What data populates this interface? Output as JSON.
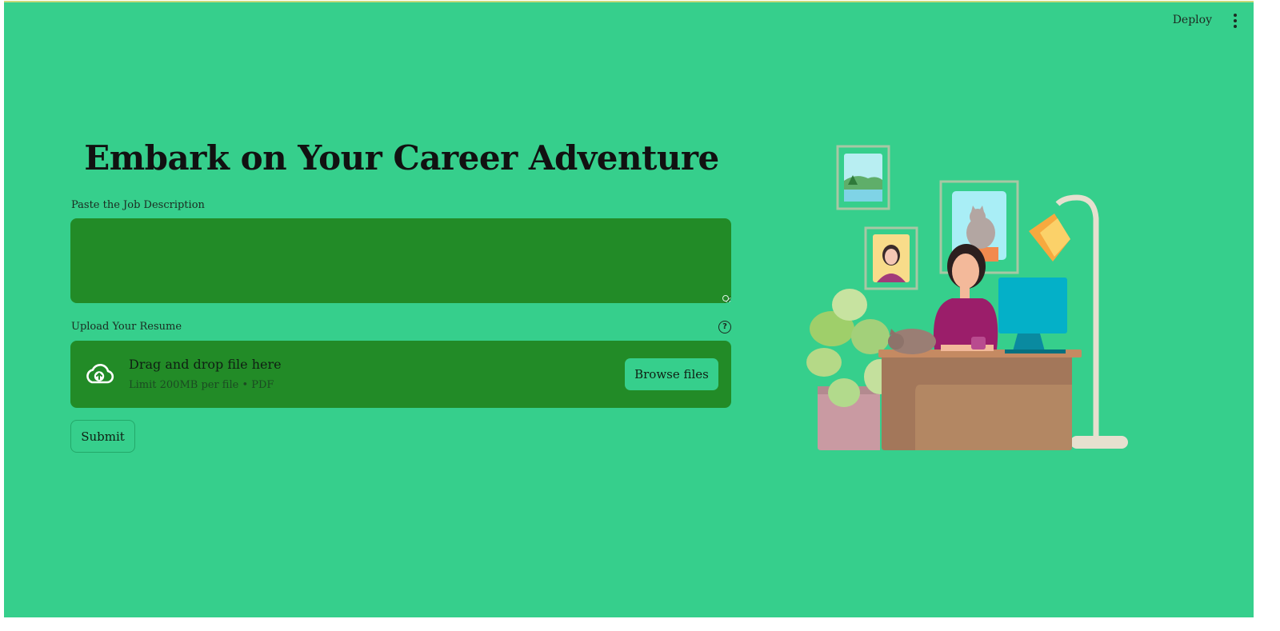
{
  "header": {
    "deploy_label": "Deploy",
    "menu_icon": "kebab-menu-icon"
  },
  "main": {
    "title": "Embark on Your Career Adventure",
    "job_description": {
      "label": "Paste the Job Description",
      "value": "",
      "placeholder": ""
    },
    "resume_upload": {
      "label": "Upload Your Resume",
      "help_icon": "help-circle-icon",
      "dropzone_text": "Drag and drop file here",
      "limit_text": "Limit 200MB per file • PDF",
      "browse_label": "Browse files",
      "upload_icon": "cloud-upload-icon"
    },
    "submit_label": "Submit"
  },
  "illustration": {
    "subject": "woman-at-desk-illustration"
  },
  "colors": {
    "background": "#36cf8c",
    "input_background": "#228b27",
    "text": "#111111"
  }
}
